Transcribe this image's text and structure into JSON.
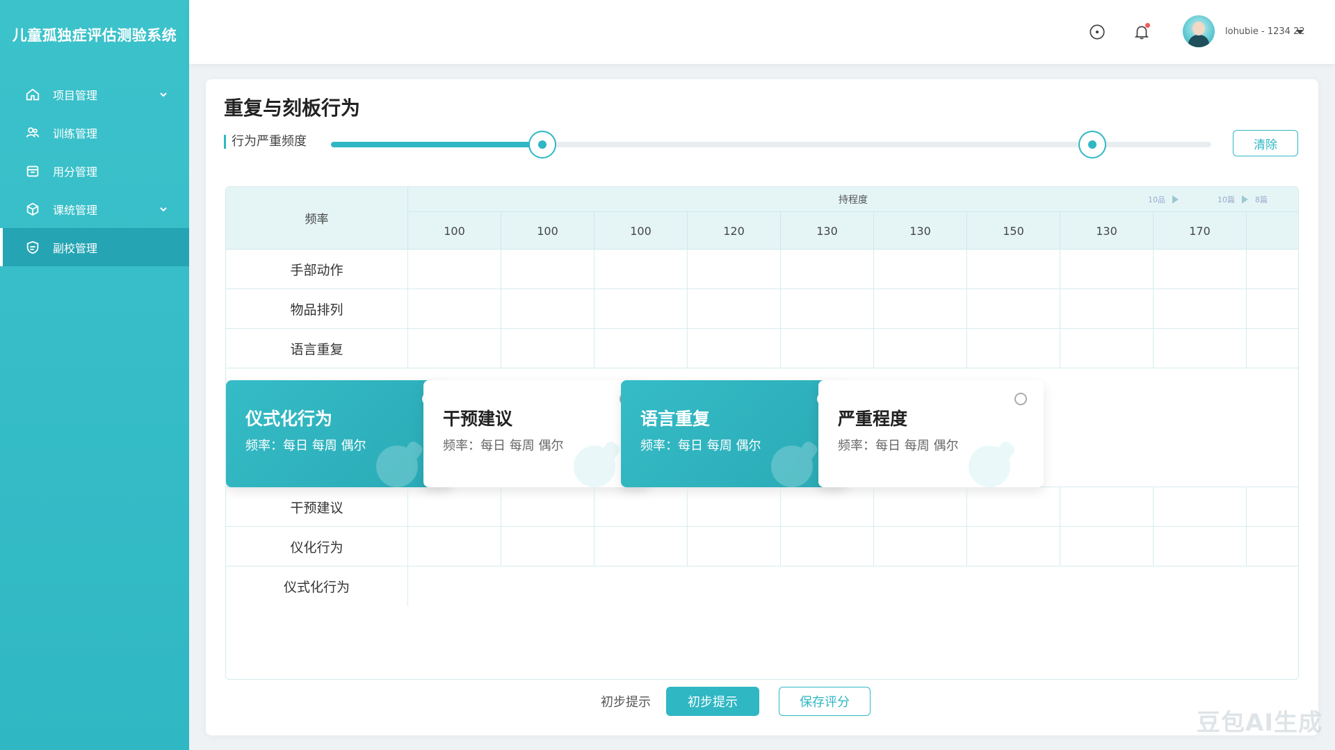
{
  "app": {
    "brand": "儿童孤独症评估测验系统"
  },
  "sidebar": {
    "items": [
      {
        "label": "项目管理",
        "icon": "home-icon",
        "expandable": true
      },
      {
        "label": "训练管理",
        "icon": "users-icon",
        "expandable": false
      },
      {
        "label": "用分管理",
        "icon": "calendar-icon",
        "expandable": false
      },
      {
        "label": "课统管理",
        "icon": "cube-icon",
        "expandable": true
      },
      {
        "label": "副校管理",
        "icon": "shield-icon",
        "expandable": false,
        "active": true
      }
    ]
  },
  "header": {
    "user_name": "lohubie - 1234 22"
  },
  "page": {
    "title": "重复与刻板行为",
    "slider_label": "行为严重频度",
    "slider_values": [
      0.24,
      0.865
    ],
    "clear_label": "清除"
  },
  "table": {
    "head_label": "频率",
    "group_title": "持程度",
    "tiny_ctrls": [
      "10品",
      "10篇",
      "8篇"
    ],
    "ticks": [
      "100",
      "100",
      "100",
      "120",
      "130",
      "130",
      "150",
      "130",
      "170"
    ],
    "rows_top": [
      "手部动作",
      "物品排列",
      "语言重复"
    ],
    "rows_bottom": [
      "干预建议",
      "仪化行为",
      "仪式化行为"
    ]
  },
  "cards": [
    {
      "title": "仪式化行为",
      "sub": "频率：每日 每周 偶尔",
      "style": "teal"
    },
    {
      "title": "干预建议",
      "sub": "频率：每日 每周 偶尔",
      "style": "white"
    },
    {
      "title": "语言重复",
      "sub": "频率：每日 每周 偶尔",
      "style": "teal"
    },
    {
      "title": "严重程度",
      "sub": "频率：每日 每周 偶尔",
      "style": "white"
    }
  ],
  "footer": {
    "hint": "初步提示",
    "primary": "初步提示",
    "secondary": "保存评分"
  },
  "watermark": "豆包AI生成",
  "colors": {
    "accent": "#2fb7c3",
    "sidebar": "#3cc2cb",
    "active": "#25a4b3"
  }
}
